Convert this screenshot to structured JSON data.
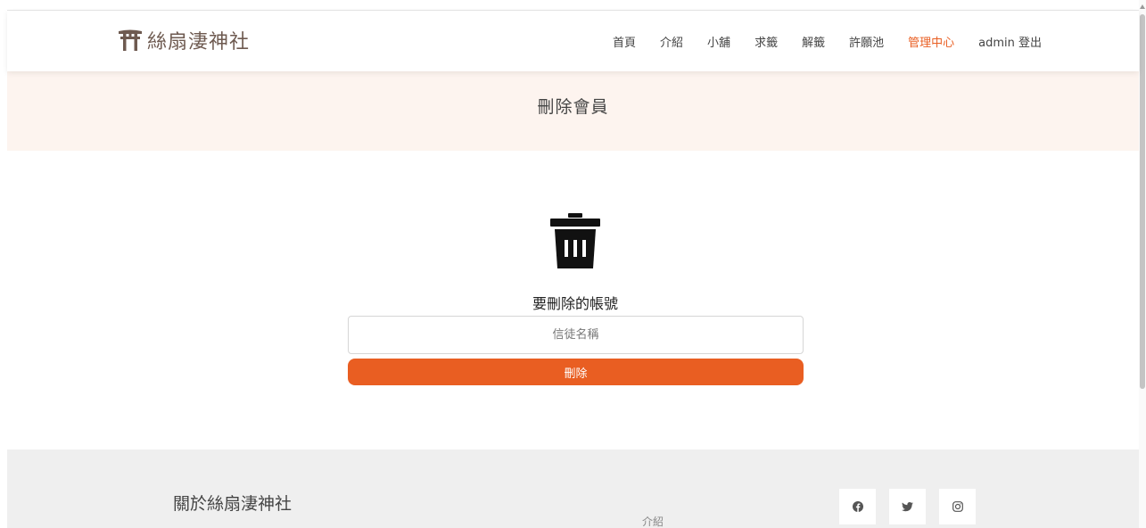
{
  "brand": {
    "name": "絲扇淒神社",
    "icon": "torii-icon"
  },
  "nav": {
    "items": [
      {
        "label": "首頁",
        "name": "nav-home"
      },
      {
        "label": "介紹",
        "name": "nav-intro"
      },
      {
        "label": "小舖",
        "name": "nav-shop"
      },
      {
        "label": "求籤",
        "name": "nav-draw-lot"
      },
      {
        "label": "解籤",
        "name": "nav-interpret-lot"
      },
      {
        "label": "許願池",
        "name": "nav-wishing-pool"
      },
      {
        "label": "管理中心",
        "name": "nav-admin-center",
        "active": true
      },
      {
        "label": "admin 登出",
        "name": "nav-logout"
      }
    ]
  },
  "banner": {
    "title": "刪除會員"
  },
  "form": {
    "icon": "trash-icon",
    "label": "要刪除的帳號",
    "input_placeholder": "信徒名稱",
    "input_value": "",
    "submit_label": "刪除"
  },
  "footer": {
    "about_title": "關於絲扇淒神社",
    "link_label": "介紹",
    "social": [
      "facebook-icon",
      "twitter-icon",
      "instagram-icon"
    ]
  },
  "colors": {
    "accent": "#e95e22",
    "banner_bg": "#fdf4ef",
    "footer_bg": "#efefef",
    "brand_text": "#6e5a50"
  }
}
